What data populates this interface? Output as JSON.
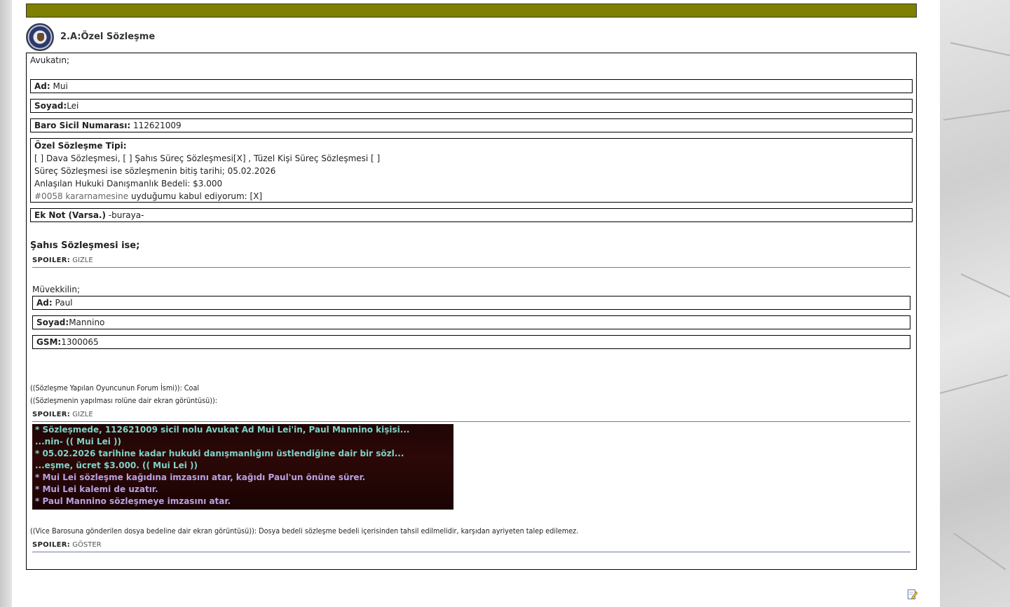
{
  "post": {
    "title": "2.A:Özel Sözleşme",
    "section_lawyer": "Avukatın;",
    "lawyer": {
      "name_label": "Ad:",
      "name_value": "Mui",
      "surname_label": "Soyad:",
      "surname_value": "Lei",
      "bar_label": "Baro Sicil Numarası:",
      "bar_value": "112621009"
    },
    "contract": {
      "type_label": "Özel Sözleşme Tipi:",
      "type_line": "[ ] Dava Sözleşmesi, [ ] Şahıs Süreç Sözleşmesi[X] , Tüzel Kişi Süreç Sözleşmesi [ ]",
      "end_date_line": "Süreç Sözleşmesi ise sözleşmenin bitiş tarihi; 05.02.2026",
      "fee_line": "Anlaşılan Hukuki Danışmanlık Bedeli: $3.000",
      "decree_ref": "#0058 kararnamesine",
      "decree_rest": " uyduğumu kabul ediyorum: [X]"
    },
    "note": {
      "label": "Ek Not (Varsa.)",
      "value": " -buraya-"
    },
    "personal_heading": "Şahıs Sözleşmesi ise;",
    "spoiler1": {
      "key": "SPOILER:",
      "state": "GIZLE"
    },
    "client": {
      "heading": "Müvekkilin;",
      "name_label": "Ad:",
      "name_value": "Paul",
      "surname_label": "Soyad:",
      "surname_value": "Mannino",
      "gsm_label": "GSM:",
      "gsm_value": "1300065"
    },
    "forum_name_line": "((Sözleşme Yapılan Oyuncunun Forum İsmi)): Coal",
    "screenshot_line": "((Sözleşmenin yapılması rolüne dair ekran görüntüsü)):",
    "spoiler2": {
      "key": "SPOILER:",
      "state": "GIZLE"
    },
    "chat_lines": [
      {
        "text": "* Sözleşmede, 112621009 sicil nolu Avukat Ad Mui Lei'in, Paul Mannino kişisi...",
        "kind": "do"
      },
      {
        "text": "...nin- (( Mui Lei ))",
        "kind": "do"
      },
      {
        "text": "* 05.02.2026 tarihine kadar hukuki danışmanlığını üstlendiğine dair bir sözl...",
        "kind": "do"
      },
      {
        "text": "...eşme, ücret $3.000. (( Mui Lei ))",
        "kind": "do"
      },
      {
        "text": "* Mui Lei sözleşme kağıdına imzasını atar, kağıdı Paul'un önüne sürer.",
        "kind": "me"
      },
      {
        "text": "* Mui Lei kalemi de uzatır.",
        "kind": "me"
      },
      {
        "text": "* Paul Mannino sözleşmeye imzasını atar.",
        "kind": "me"
      }
    ],
    "fee_screenshot_line": "((Vice Barosuna gönderilen dosya bedeline dair ekran görüntüsü)): Dosya bedeli sözleşme bedeli içerisinden tahsil edilmelidir, karşıdan ayriyeten talep edilemez.",
    "spoiler3": {
      "key": "SPOILER:",
      "state": "GÖSTER"
    }
  },
  "colors": {
    "topbar": "#808000",
    "chat_me": "#b8a2e3",
    "chat_do": "#7fd2c6",
    "chat_bg": "#200505"
  },
  "icons": {
    "seal": "law-firm-seal-icon",
    "edit": "edit-post-icon"
  }
}
